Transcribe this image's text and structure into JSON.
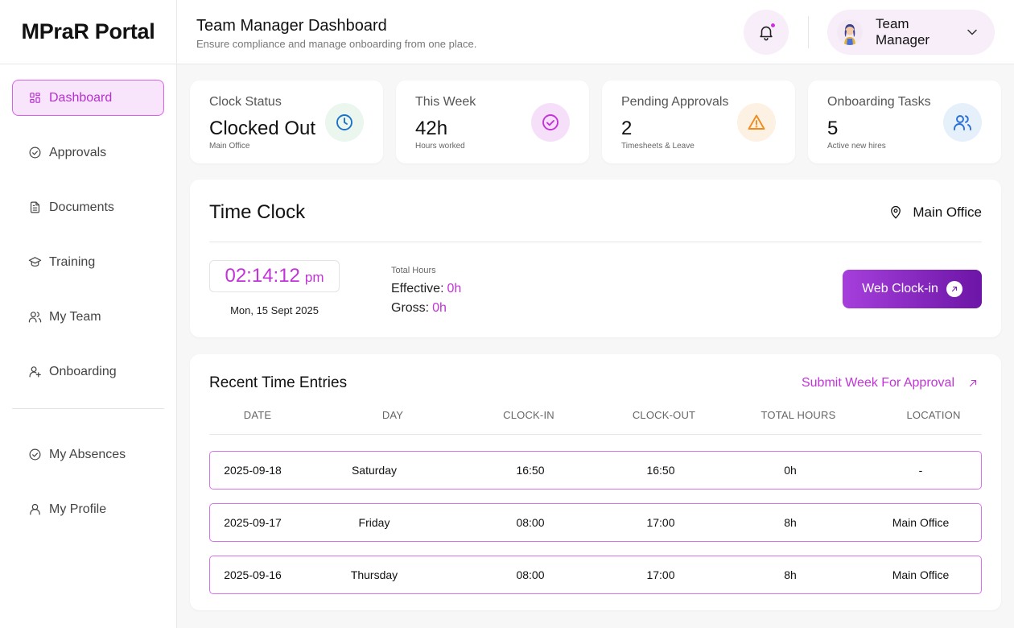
{
  "app": {
    "logo": "MPraR Portal"
  },
  "header": {
    "title": "Team Manager Dashboard",
    "subtitle": "Ensure compliance and manage onboarding from one place.",
    "user_name": "Team Manager"
  },
  "sidebar": {
    "items": [
      {
        "label": "Dashboard",
        "icon": "grid-icon"
      },
      {
        "label": "Approvals",
        "icon": "check-circle-icon"
      },
      {
        "label": "Documents",
        "icon": "document-icon"
      },
      {
        "label": "Training",
        "icon": "graduation-cap-icon"
      },
      {
        "label": "My Team",
        "icon": "users-icon"
      },
      {
        "label": "Onboarding",
        "icon": "user-plus-icon"
      }
    ],
    "bottom_items": [
      {
        "label": "My Absences",
        "icon": "check-circle-icon"
      },
      {
        "label": "My Profile",
        "icon": "user-icon"
      }
    ]
  },
  "stats": [
    {
      "label": "Clock Status",
      "value": "Clocked Out",
      "note": "Main Office",
      "icon": "clock-icon",
      "color": "#1a73c8",
      "bg": "#eaf6ee"
    },
    {
      "label": "This Week",
      "value": "42h",
      "note": "Hours worked",
      "icon": "check-circle-icon",
      "color": "#c233d8",
      "bg": "#f6dff9"
    },
    {
      "label": "Pending Approvals",
      "value": "2",
      "note": "Timesheets & Leave",
      "icon": "warning-icon",
      "color": "#ef8c1c",
      "bg": "#fdf1e4"
    },
    {
      "label": "Onboarding Tasks",
      "value": "5",
      "note": "Active new hires",
      "icon": "users-icon",
      "color": "#2a6fd6",
      "bg": "#e6f0fb"
    }
  ],
  "time_clock": {
    "title": "Time Clock",
    "location": "Main Office",
    "time": "02:14:12",
    "ampm": "pm",
    "date": "Mon, 15 Sept 2025",
    "total_hours_label": "Total Hours",
    "effective_label": "Effective:",
    "effective_value": "0h",
    "gross_label": "Gross:",
    "gross_value": "0h",
    "button_label": "Web Clock-in"
  },
  "recent_entries": {
    "title": "Recent Time Entries",
    "submit_link": "Submit Week For Approval",
    "columns": [
      "DATE",
      "DAY",
      "CLOCK-IN",
      "CLOCK-OUT",
      "TOTAL HOURS",
      "LOCATION"
    ],
    "rows": [
      [
        "2025-09-18",
        "Saturday",
        "16:50",
        "16:50",
        "0h",
        "-"
      ],
      [
        "2025-09-17",
        "Friday",
        "08:00",
        "17:00",
        "8h",
        "Main Office"
      ],
      [
        "2025-09-16",
        "Thursday",
        "08:00",
        "17:00",
        "8h",
        "Main Office"
      ]
    ]
  },
  "colors": {
    "accent": "#c233d8",
    "active_bg": "#f8e5fb",
    "button_start": "#a63fdc",
    "button_end": "#6c15a6"
  }
}
